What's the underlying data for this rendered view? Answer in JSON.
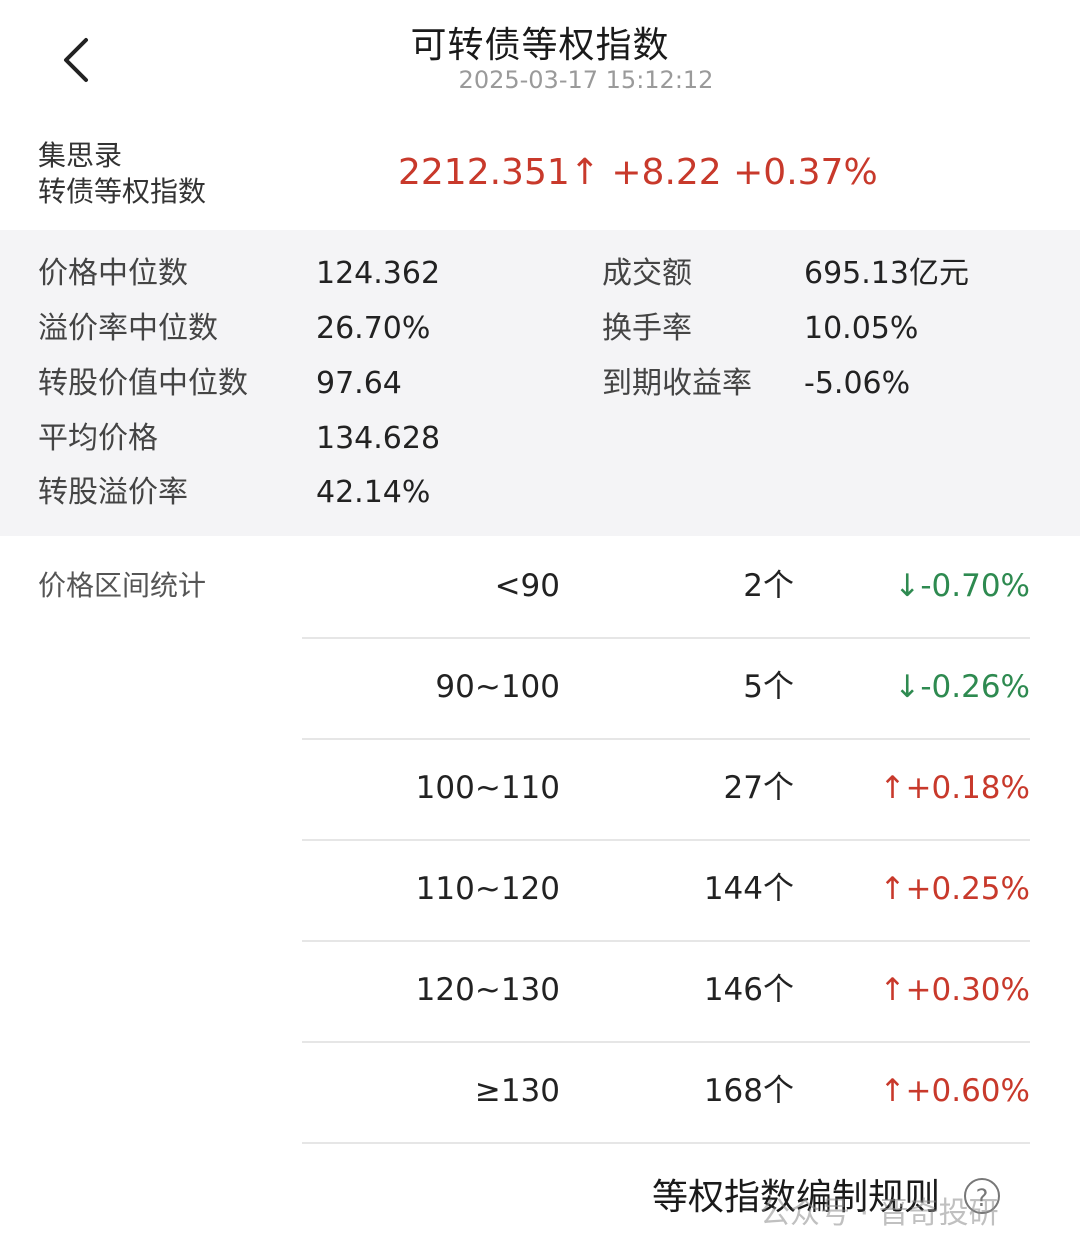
{
  "header": {
    "title": "可转债等权指数",
    "timestamp": "2025-03-17 15:12:12"
  },
  "summary": {
    "label_line1": "集思录",
    "label_line2": "转债等权指数",
    "value": "2212.351↑ +8.22 +0.37%",
    "color": "#c8392b"
  },
  "stats": {
    "left": [
      {
        "label": "价格中位数",
        "value": "124.362"
      },
      {
        "label": "溢价率中位数",
        "value": "26.70%"
      },
      {
        "label": "转股价值中位数",
        "value": "97.64"
      },
      {
        "label": "平均价格",
        "value": "134.628"
      },
      {
        "label": "转股溢价率",
        "value": "42.14%"
      }
    ],
    "right": [
      {
        "label": "成交额",
        "value": "695.13亿元"
      },
      {
        "label": "换手率",
        "value": "10.05%"
      },
      {
        "label": "到期收益率",
        "value": "-5.06%"
      }
    ]
  },
  "price_ranges": {
    "title": "价格区间统计",
    "rows": [
      {
        "range": "<90",
        "count": "2个",
        "change": "↓-0.70%",
        "direction": "down"
      },
      {
        "range": "90~100",
        "count": "5个",
        "change": "↓-0.26%",
        "direction": "down"
      },
      {
        "range": "100~110",
        "count": "27个",
        "change": "↑+0.18%",
        "direction": "up"
      },
      {
        "range": "110~120",
        "count": "144个",
        "change": "↑+0.25%",
        "direction": "up"
      },
      {
        "range": "120~130",
        "count": "146个",
        "change": "↑+0.30%",
        "direction": "up"
      },
      {
        "range": "≥130",
        "count": "168个",
        "change": "↑+0.60%",
        "direction": "up"
      }
    ]
  },
  "footer": {
    "rules_link": "等权指数编制规则",
    "help_icon": "question-circle-icon",
    "watermark": "公众号 · 晋奇投研"
  },
  "colors": {
    "up": "#c8392b",
    "down": "#2e8a50",
    "stats_bg": "#f4f4f6"
  }
}
